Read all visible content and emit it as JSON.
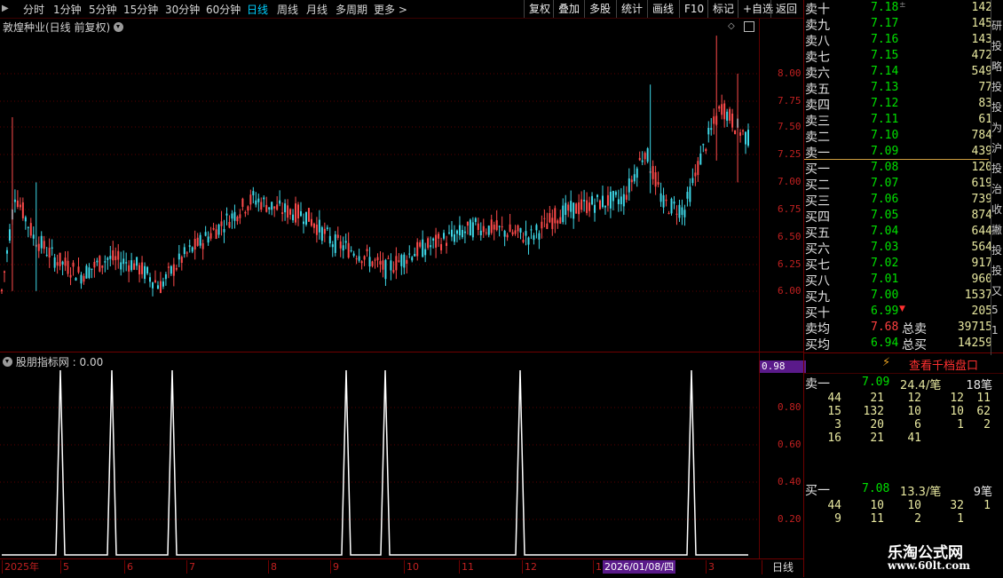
{
  "toolbar": {
    "periods": [
      "分时",
      "1分钟",
      "5分钟",
      "15分钟",
      "30分钟",
      "60分钟",
      "日线",
      "周线",
      "月线",
      "多周期",
      "更多 >"
    ],
    "active_period": "日线",
    "right_buttons": [
      "复权",
      "叠加",
      "多股",
      "统计",
      "画线",
      "F10",
      "+自选",
      "返回"
    ],
    "mark_label": "标记"
  },
  "main_chart": {
    "title": "敦煌种业(日线 前复权)",
    "y_ticks": [
      "8.00",
      "7.75",
      "7.50",
      "7.25",
      "7.00",
      "6.75",
      "6.50",
      "6.25",
      "6.00"
    ],
    "up_color": "#ff4b4b",
    "down_color": "#3ed8e8"
  },
  "indicator": {
    "title": "股朋指标网 : 0.00",
    "y_ticks": [
      "0.80",
      "0.60",
      "0.40",
      "0.20"
    ],
    "current_value": "0.98",
    "spike_color": "#ffffff"
  },
  "time_axis": {
    "labels": [
      "2025年",
      "5",
      "6",
      "7",
      "8",
      "9",
      "10",
      "11",
      "12",
      "1",
      "3"
    ],
    "cursor_date": "2026/01/08/四",
    "period_label": "日线"
  },
  "order_book": {
    "asks": [
      {
        "label": "卖十",
        "price": "7.18",
        "volume": "142",
        "marker": "±"
      },
      {
        "label": "卖九",
        "price": "7.17",
        "volume": "145"
      },
      {
        "label": "卖八",
        "price": "7.16",
        "volume": "143"
      },
      {
        "label": "卖七",
        "price": "7.15",
        "volume": "472"
      },
      {
        "label": "卖六",
        "price": "7.14",
        "volume": "549"
      },
      {
        "label": "卖五",
        "price": "7.13",
        "volume": "77"
      },
      {
        "label": "卖四",
        "price": "7.12",
        "volume": "83"
      },
      {
        "label": "卖三",
        "price": "7.11",
        "volume": "61"
      },
      {
        "label": "卖二",
        "price": "7.10",
        "volume": "784"
      },
      {
        "label": "卖一",
        "price": "7.09",
        "volume": "439"
      }
    ],
    "bids": [
      {
        "label": "买一",
        "price": "7.08",
        "volume": "120"
      },
      {
        "label": "买二",
        "price": "7.07",
        "volume": "619"
      },
      {
        "label": "买三",
        "price": "7.06",
        "volume": "739"
      },
      {
        "label": "买四",
        "price": "7.05",
        "volume": "874"
      },
      {
        "label": "买五",
        "price": "7.04",
        "volume": "644"
      },
      {
        "label": "买六",
        "price": "7.03",
        "volume": "564"
      },
      {
        "label": "买七",
        "price": "7.02",
        "volume": "917"
      },
      {
        "label": "买八",
        "price": "7.01",
        "volume": "960"
      },
      {
        "label": "买九",
        "price": "7.00",
        "volume": "1537"
      },
      {
        "label": "买十",
        "price": "6.99",
        "volume": "205",
        "marker": "▼"
      }
    ],
    "sell_avg": {
      "label": "卖均",
      "price": "7.68",
      "total_label": "总卖",
      "total": "39715"
    },
    "buy_avg": {
      "label": "买均",
      "price": "6.94",
      "total_label": "总买",
      "total": "14259"
    }
  },
  "thousand_level": {
    "button_label": "查看千档盘口",
    "ask1": {
      "label": "卖一",
      "price": "7.09",
      "avg": "24.4/笔",
      "count": "18笔"
    },
    "ask_rows": [
      [
        "44",
        "21",
        "12",
        "12",
        "11"
      ],
      [
        "15",
        "132",
        "10",
        "10",
        "62"
      ],
      [
        "3",
        "20",
        "6",
        "1",
        "2"
      ],
      [
        "16",
        "21",
        "41",
        "",
        ""
      ]
    ],
    "bid1": {
      "label": "买一",
      "price": "7.08",
      "avg": "13.3/笔",
      "count": "9笔"
    },
    "bid_rows": [
      [
        "44",
        "10",
        "10",
        "32",
        "1"
      ],
      [
        "9",
        "11",
        "2",
        "1",
        ""
      ]
    ]
  },
  "side_strip": [
    "研",
    "投",
    "略",
    "投",
    "投",
    "为",
    "沪",
    "投",
    "治",
    "收",
    "撇",
    "投",
    "投",
    "又",
    "5",
    "1"
  ],
  "watermark": {
    "title": "乐淘公式网",
    "url": "www.60lt.com"
  }
}
